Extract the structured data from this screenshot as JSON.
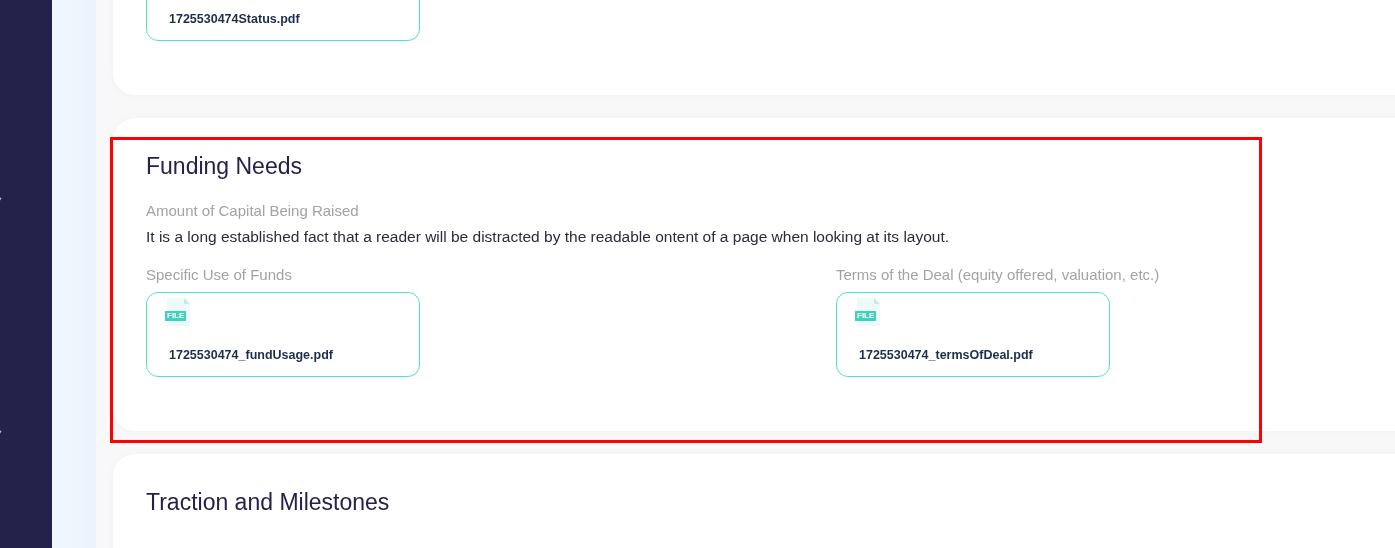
{
  "sections": [
    {
      "fields": [
        {
          "kind": "files",
          "files": [
            {
              "name": "1725530474Status.pdf"
            }
          ]
        }
      ]
    },
    {
      "title": "Funding Needs",
      "highlighted": true,
      "fields": [
        {
          "kind": "text",
          "label": "Amount of Capital Being Raised",
          "value": "It is a long established fact that a reader will be distracted by the readable ontent of a page when looking at its layout."
        },
        {
          "kind": "files",
          "label": "Specific Use of Funds",
          "files": [
            {
              "name": "1725530474_fundUsage.pdf",
              "badge": "FILE"
            }
          ]
        },
        {
          "kind": "files",
          "label": "Terms of the Deal (equity offered, valuation, etc.)",
          "files": [
            {
              "name": "1725530474_termsOfDeal.pdf",
              "badge": "FILE"
            }
          ]
        }
      ]
    },
    {
      "title": "Traction and Milestones"
    }
  ]
}
